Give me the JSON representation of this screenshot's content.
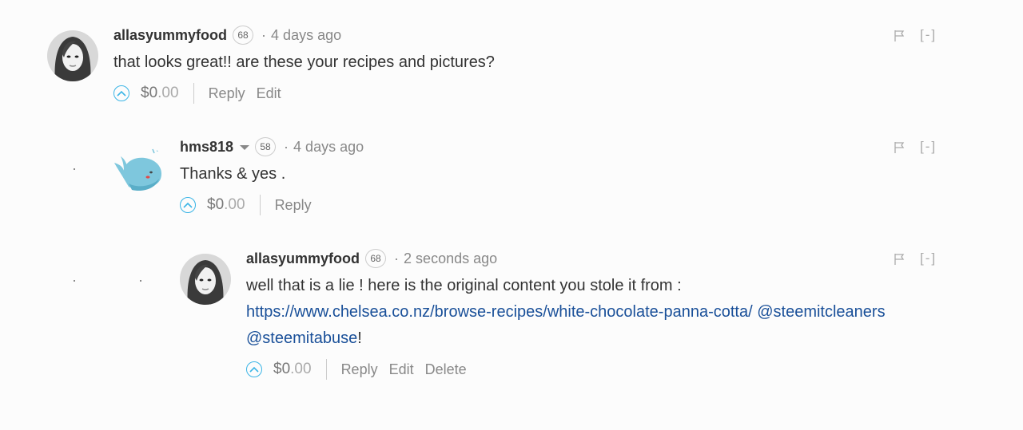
{
  "comments": [
    {
      "author": "allasyummyfood",
      "reputation": "68",
      "time": "4 days ago",
      "lines": [
        "that looks great!! are these your recipes and pictures?"
      ],
      "payout_main": "$0",
      "payout_cents": ".00",
      "actions": [
        "Reply",
        "Edit"
      ],
      "collapse": "[-]",
      "avatar_icon": "woman-portrait-avatar"
    },
    {
      "author": "hms818",
      "reputation": "58",
      "time": "4 days ago",
      "lines": [
        "Thanks & yes ."
      ],
      "payout_main": "$0",
      "payout_cents": ".00",
      "actions": [
        "Reply"
      ],
      "collapse": "[-]",
      "avatar_icon": "whale-avatar"
    },
    {
      "author": "allasyummyfood",
      "reputation": "68",
      "time": "2 seconds ago",
      "line1": "well that is a lie ! here is the original content you stole it from :",
      "link1": "https://www.chelsea.co.nz/browse-recipes/white-chocolate-panna-cotta/",
      "mention1": "@steemitcleaners",
      "mention2": "@steemitabuse",
      "trail": "!",
      "payout_main": "$0",
      "payout_cents": ".00",
      "actions": [
        "Reply",
        "Edit",
        "Delete"
      ],
      "collapse": "[-]",
      "avatar_icon": "woman-portrait-avatar"
    }
  ],
  "colors": {
    "link": "#1a5099",
    "vote": "#3bb5e6",
    "muted": "#888888"
  }
}
